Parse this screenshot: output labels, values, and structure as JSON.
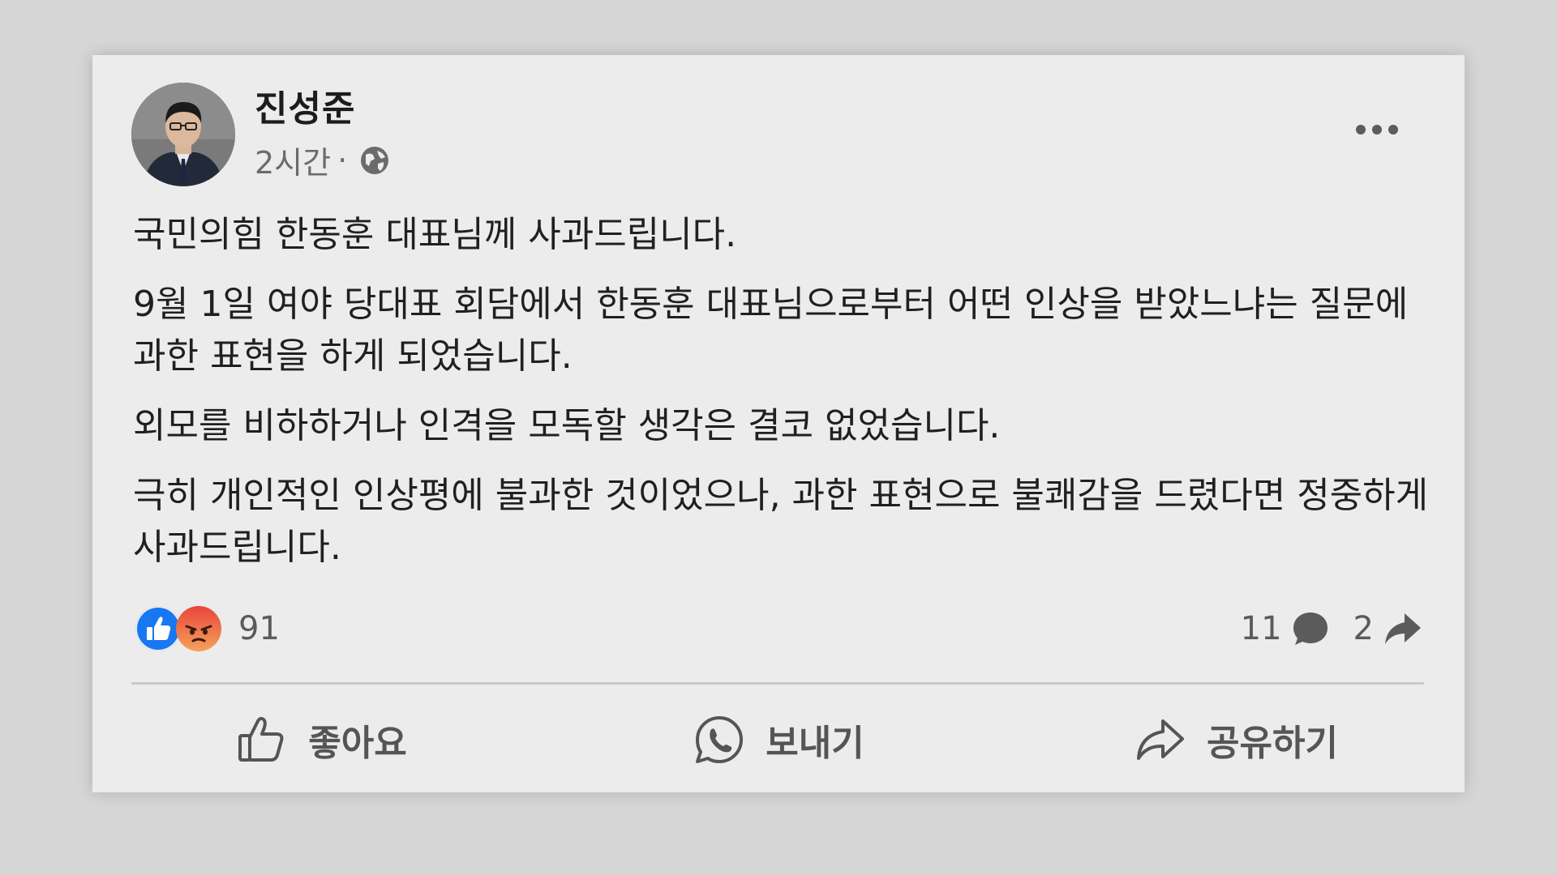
{
  "post": {
    "author": "진성준",
    "time": "2시간",
    "separator": "·",
    "privacy_icon": "globe-icon",
    "paragraphs": [
      "국민의힘 한동훈 대표님께 사과드립니다.",
      "9월 1일 여야 당대표 회담에서 한동훈 대표님으로부터 어떤 인상을 받았느냐는 질문에 과한 표현을 하게 되었습니다.",
      "외모를 비하하거나 인격을 모독할 생각은 결코 없었습니다.",
      "극히 개인적인 인상평에 불과한 것이었으나, 과한 표현으로 불쾌감을 드렸다면 정중하게 사과드립니다."
    ]
  },
  "reactions": {
    "icons": [
      "like-icon",
      "angry-icon"
    ],
    "count": "91"
  },
  "stats": {
    "comments": "11",
    "shares": "2"
  },
  "actions": {
    "like": "좋아요",
    "send": "보내기",
    "share": "공유하기"
  },
  "colors": {
    "like_blue": "#1877f2",
    "angry_orange": "#f26b3a",
    "card_bg": "#ececec",
    "page_bg": "#d6d6d6"
  }
}
